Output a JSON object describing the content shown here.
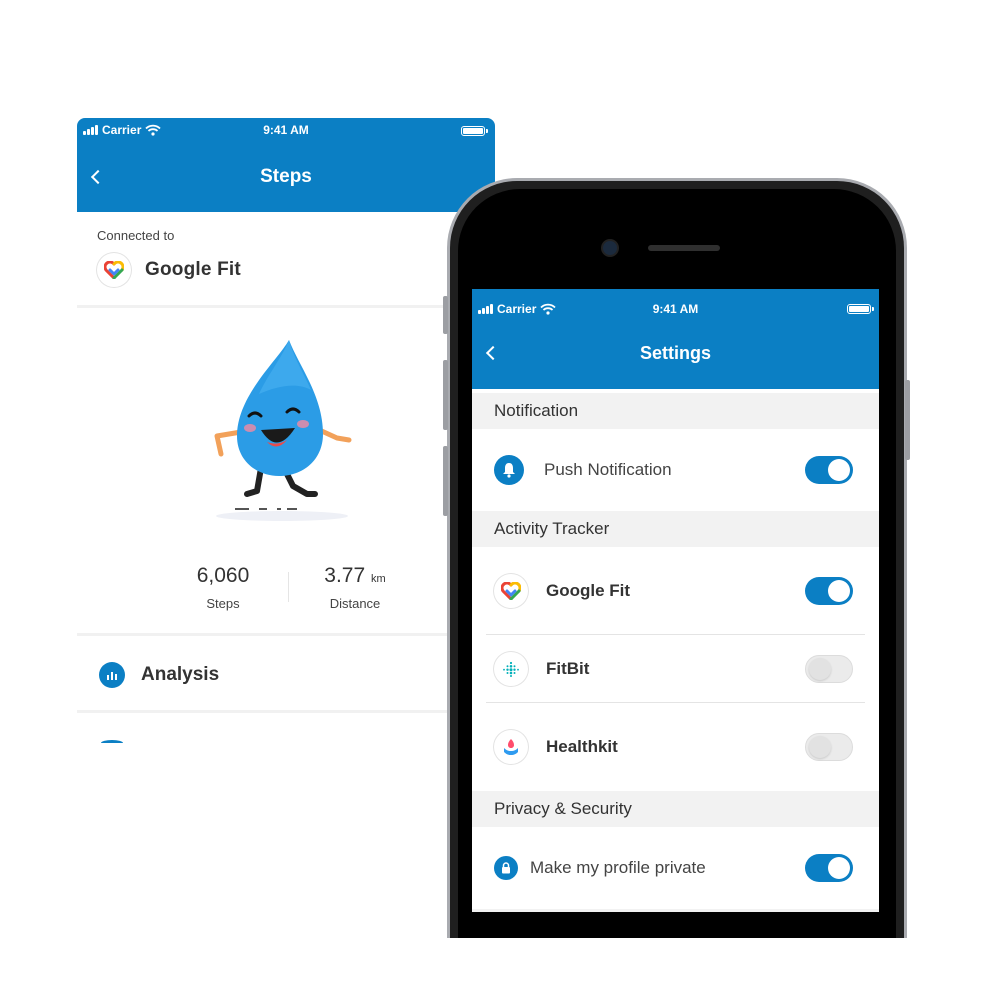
{
  "colors": {
    "primary": "#0b7fc4",
    "toggle_off": "#ebebeb",
    "section_bg": "#f2f2f2"
  },
  "steps_screen": {
    "status_bar": {
      "carrier": "Carrier",
      "time": "9:41 AM"
    },
    "title": "Steps",
    "connected_label": "Connected to",
    "connected_app": "Google Fit",
    "steps_value": "6,060",
    "steps_label": "Steps",
    "distance_value": "3.77",
    "distance_unit": "km",
    "distance_label": "Distance",
    "analysis_label": "Analysis"
  },
  "settings_screen": {
    "status_bar": {
      "carrier": "Carrier",
      "time": "9:41 AM"
    },
    "title": "Settings",
    "sections": {
      "notification": {
        "title": "Notification",
        "push_label": "Push Notification",
        "push_on": true
      },
      "activity_tracker": {
        "title": "Activity Tracker",
        "items": [
          {
            "label": "Google Fit",
            "icon": "google-fit-icon",
            "on": true
          },
          {
            "label": "FitBit",
            "icon": "fitbit-icon",
            "on": false
          },
          {
            "label": "Healthkit",
            "icon": "healthkit-icon",
            "on": false
          }
        ]
      },
      "privacy": {
        "title": "Privacy & Security",
        "private_label": "Make my profile private",
        "private_on": true
      }
    }
  }
}
